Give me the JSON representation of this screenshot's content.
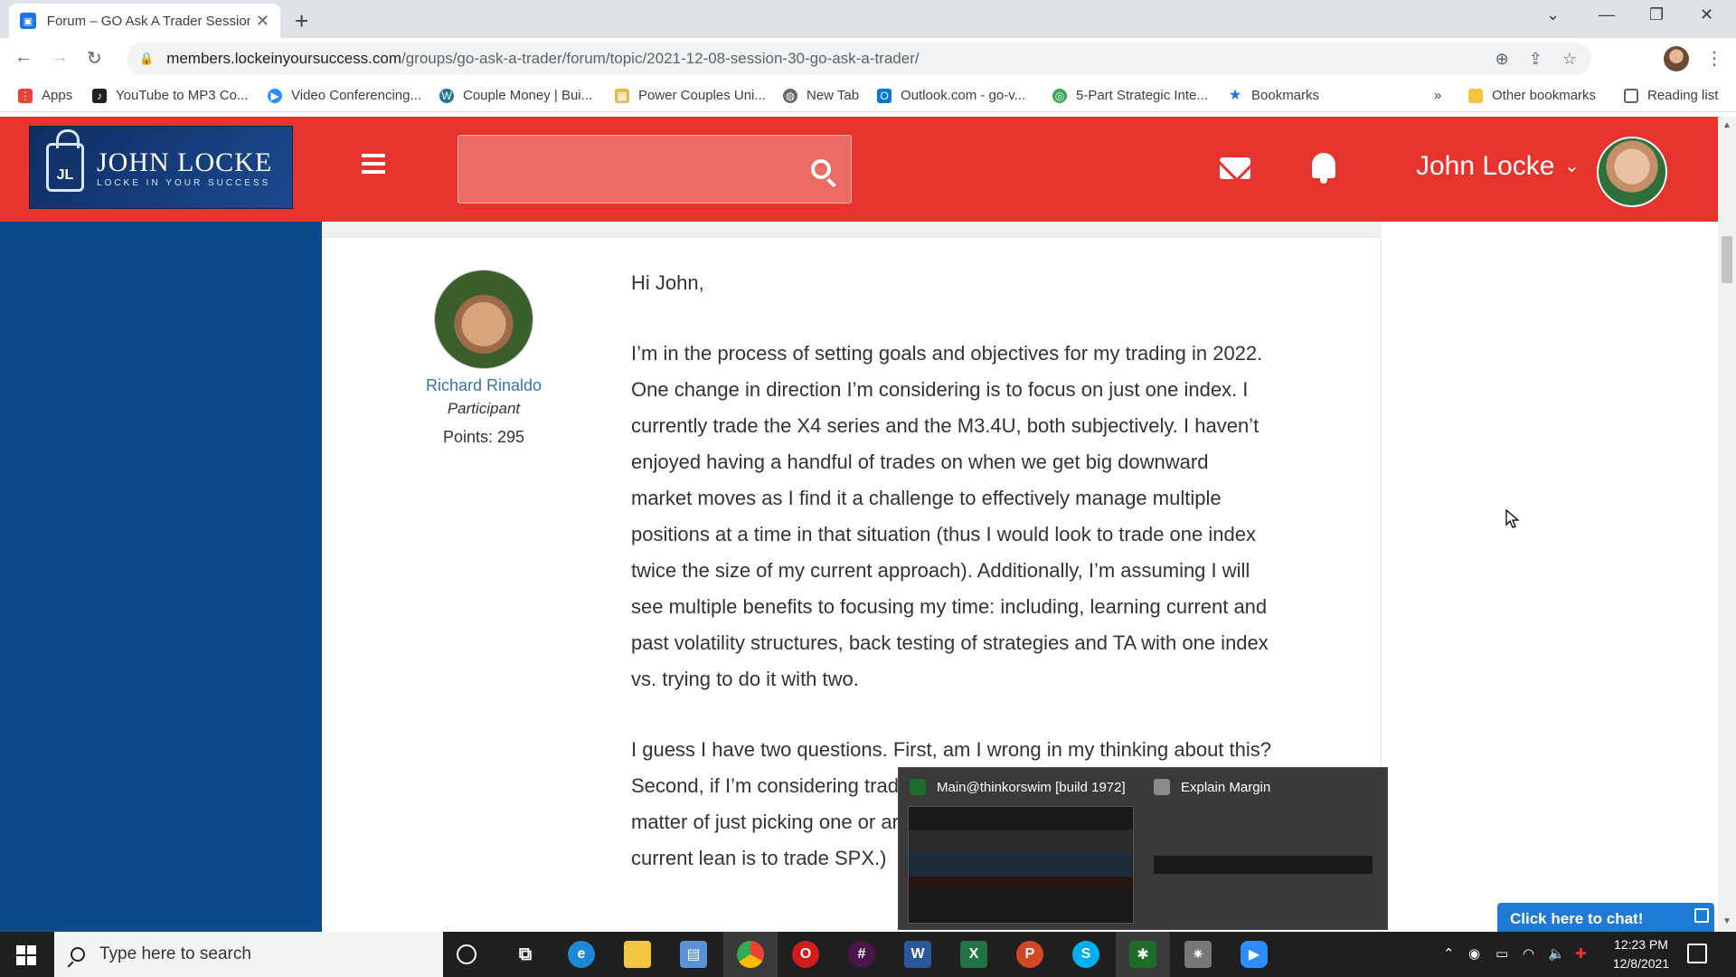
{
  "browser": {
    "tab_title": "Forum – GO Ask A Trader Session",
    "url_host": "members.lockeinyoursuccess.com",
    "url_path": "/groups/go-ask-a-trader/forum/topic/2021-12-08-session-30-go-ask-a-trader/",
    "bookmarks": [
      {
        "label": "Apps",
        "icon": "apps-grid-icon",
        "color": "#ea4335"
      },
      {
        "label": "YouTube to MP3 Co...",
        "icon": "music-note-icon",
        "color": "#202124"
      },
      {
        "label": "Video Conferencing...",
        "icon": "zoom-icon",
        "color": "#2d8cff"
      },
      {
        "label": "Couple Money | Bui...",
        "icon": "wordpress-icon",
        "color": "#21759b"
      },
      {
        "label": "Power Couples Uni...",
        "icon": "folder-thumb-icon",
        "color": "#e8b84a"
      },
      {
        "label": "New Tab",
        "icon": "globe-icon",
        "color": "#5f6368"
      },
      {
        "label": "Outlook.com - go-v...",
        "icon": "outlook-icon",
        "color": "#0078d4"
      },
      {
        "label": "5-Part Strategic Inte...",
        "icon": "spiral-icon",
        "color": "#34a853"
      },
      {
        "label": "Bookmarks",
        "icon": "star-icon",
        "color": "#1a73e8"
      }
    ],
    "more_bookmarks": "»",
    "other_bookmarks": "Other bookmarks",
    "reading_list": "Reading list"
  },
  "site": {
    "logo_name": "JOHN LOCKE",
    "logo_tagline": "LOCKE IN YOUR SUCCESS",
    "logo_mark": "JL",
    "user_name": "John Locke",
    "accent_color": "#e5342d",
    "sidebar_color": "#0c4a8a"
  },
  "post": {
    "author_name": "Richard Rinaldo",
    "author_role": "Participant",
    "author_points": "Points: 295",
    "paragraphs": [
      "Hi John,",
      "I’m in the process of setting goals and objectives for my trading in 2022.  One change in direction I’m considering is to focus on just one index.  I currently trade the X4 series and the M3.4U, both subjectively.  I haven’t enjoyed having a handful of trades on when we get big downward market moves as I find it a challenge to effectively manage multiple positions at a time in that situation (thus I would look to trade one index twice the size of my current approach).  Additionally, I’m assuming I will see multiple benefits to focusing my time: including, learning current and past volatility structures, back testing of strategies and TA with one index vs. trying to do it with two.",
      "I guess I have two questions.  First, am I wrong in my thinking about this?  Second, if I’m considering trading both the RUT and SPX – – is it a matter of just picking one or are there factors I should consider?  (My current lean is to trade SPX.)"
    ]
  },
  "preview_popup": {
    "item1": "Main@thinkorswim [build 1972]",
    "item2": "Explain Margin"
  },
  "chat": {
    "label": "Click here to chat!"
  },
  "taskbar": {
    "search_placeholder": "Type here to search",
    "time": "12:23 PM",
    "date": "12/8/2021"
  }
}
